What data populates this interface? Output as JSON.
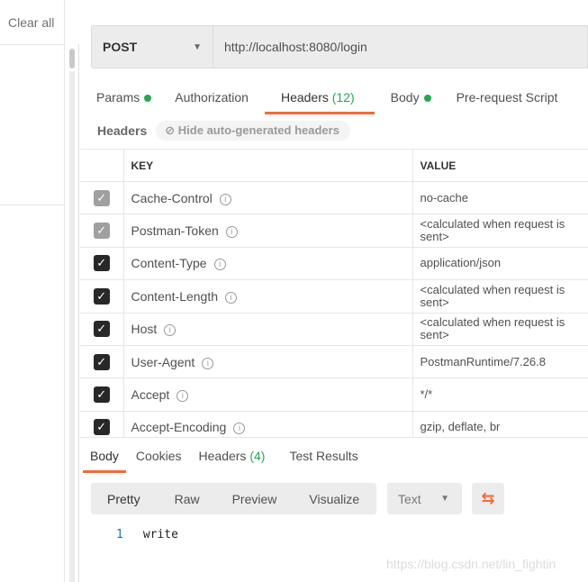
{
  "sidebar": {
    "clear_all": "Clear all"
  },
  "request": {
    "method": "POST",
    "url": "http://localhost:8080/login"
  },
  "tabs": [
    {
      "label": "Params"
    },
    {
      "label": "Authorization"
    },
    {
      "label": "Headers",
      "count": "(12)"
    },
    {
      "label": "Body"
    },
    {
      "label": "Pre-request Script"
    }
  ],
  "headers_section": {
    "label": "Headers",
    "hide_button": "Hide auto-generated headers"
  },
  "table": {
    "columns": [
      "KEY",
      "VALUE"
    ],
    "rows": [
      {
        "key": "Cache-Control",
        "value": "no-cache",
        "checked": true,
        "auto": true
      },
      {
        "key": "Postman-Token",
        "value": "<calculated when request is sent>",
        "checked": true,
        "auto": true
      },
      {
        "key": "Content-Type",
        "value": "application/json",
        "checked": true,
        "auto": false
      },
      {
        "key": "Content-Length",
        "value": "<calculated when request is sent>",
        "checked": true,
        "auto": false
      },
      {
        "key": "Host",
        "value": "<calculated when request is sent>",
        "checked": true,
        "auto": false
      },
      {
        "key": "User-Agent",
        "value": "PostmanRuntime/7.26.8",
        "checked": true,
        "auto": false
      },
      {
        "key": "Accept",
        "value": "*/*",
        "checked": true,
        "auto": false
      },
      {
        "key": "Accept-Encoding",
        "value": "gzip, deflate, br",
        "checked": true,
        "auto": false
      }
    ]
  },
  "response": {
    "tabs": [
      {
        "label": "Body"
      },
      {
        "label": "Cookies"
      },
      {
        "label": "Headers",
        "count": "(4)"
      },
      {
        "label": "Test Results"
      }
    ],
    "formats": [
      "Pretty",
      "Raw",
      "Preview",
      "Visualize"
    ],
    "type": "Text",
    "lines": [
      {
        "n": "1",
        "text": "write"
      }
    ],
    "watermark": "https://blog.csdn.net/lin_fightin"
  },
  "colors": {
    "accent": "#f26b3a",
    "green": "#26a850"
  }
}
